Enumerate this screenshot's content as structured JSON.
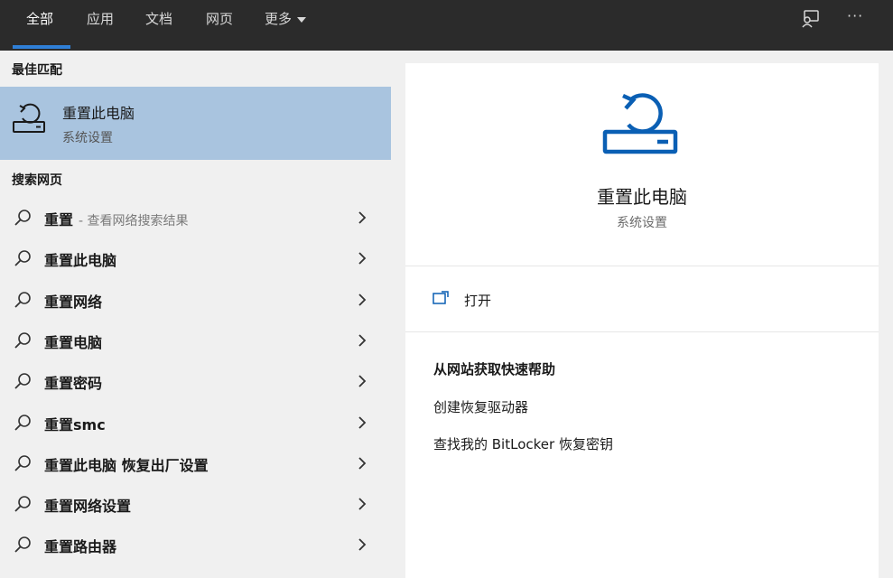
{
  "header": {
    "tabs": [
      {
        "label": "全部"
      },
      {
        "label": "应用"
      },
      {
        "label": "文档"
      },
      {
        "label": "网页"
      },
      {
        "label": "更多"
      }
    ],
    "icons": [
      "feedback-icon",
      "more-options-icon"
    ],
    "more_options_label": "···"
  },
  "left": {
    "best_match_title": "最佳匹配",
    "best_match": {
      "title": "重置此电脑",
      "subtitle": "系统设置",
      "icon": "reset-pc-icon"
    },
    "web_search_title": "搜索网页",
    "results": [
      {
        "label": "重置",
        "hint": "- 查看网络搜索结果"
      },
      {
        "label": "重置此电脑",
        "hint": ""
      },
      {
        "label": "重置网络",
        "hint": ""
      },
      {
        "label": "重置电脑",
        "hint": ""
      },
      {
        "label": "重置密码",
        "hint": ""
      },
      {
        "label": "重置smc",
        "hint": ""
      },
      {
        "label": "重置此电脑 恢复出厂设置",
        "hint": ""
      },
      {
        "label": "重置网络设置",
        "hint": ""
      },
      {
        "label": "重置路由器",
        "hint": ""
      }
    ]
  },
  "right": {
    "title": "重置此电脑",
    "subtitle": "系统设置",
    "open_label": "打开",
    "help_title": "从网站获取快速帮助",
    "help_links": [
      {
        "label": "创建恢复驱动器"
      },
      {
        "label": "查找我的 BitLocker 恢复密钥"
      }
    ]
  },
  "colors": {
    "accent": "#2f7fd6",
    "topbar": "#2b2b2b",
    "selection": "#a9c4df",
    "icon_blue": "#0a5fb4"
  }
}
